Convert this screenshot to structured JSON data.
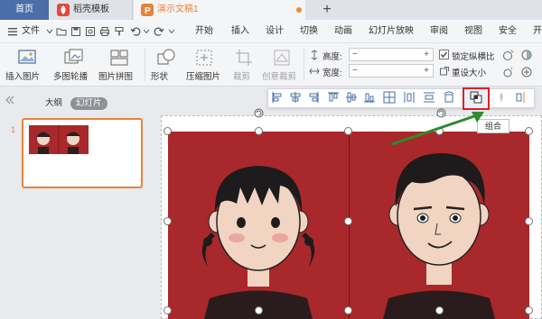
{
  "tabs": {
    "home": "首页",
    "template": "稻壳模板",
    "document": "演示文稿1",
    "new_tab": "+"
  },
  "menu": {
    "file": "文件",
    "items": [
      "开始",
      "插入",
      "设计",
      "切换",
      "动画",
      "幻灯片放映",
      "审阅",
      "视图",
      "安全",
      "开"
    ]
  },
  "ribbon": {
    "insert_picture": "插入图片",
    "multi_carousel": "多图轮播",
    "picture_collage": "图片拼图",
    "shape": "形状",
    "compress_picture": "压缩图片",
    "crop": "裁剪",
    "creative_crop": "创意裁剪",
    "height_label": "高度:",
    "width_label": "宽度:",
    "height_value": "",
    "width_value": "",
    "lock_ratio": "锁定纵横比",
    "reset_size": "重设大小"
  },
  "left_pane": {
    "outline_tab": "大纲",
    "slides_tab": "幻灯片",
    "slide_number": "1"
  },
  "tooltip": {
    "group": "组合"
  },
  "colors": {
    "accent_orange": "#e8833a",
    "tab_home_blue": "#4b6ea9",
    "highlight_red": "#e02020",
    "arrow_green": "#2e8b2e",
    "image_red": "#a9282b"
  }
}
